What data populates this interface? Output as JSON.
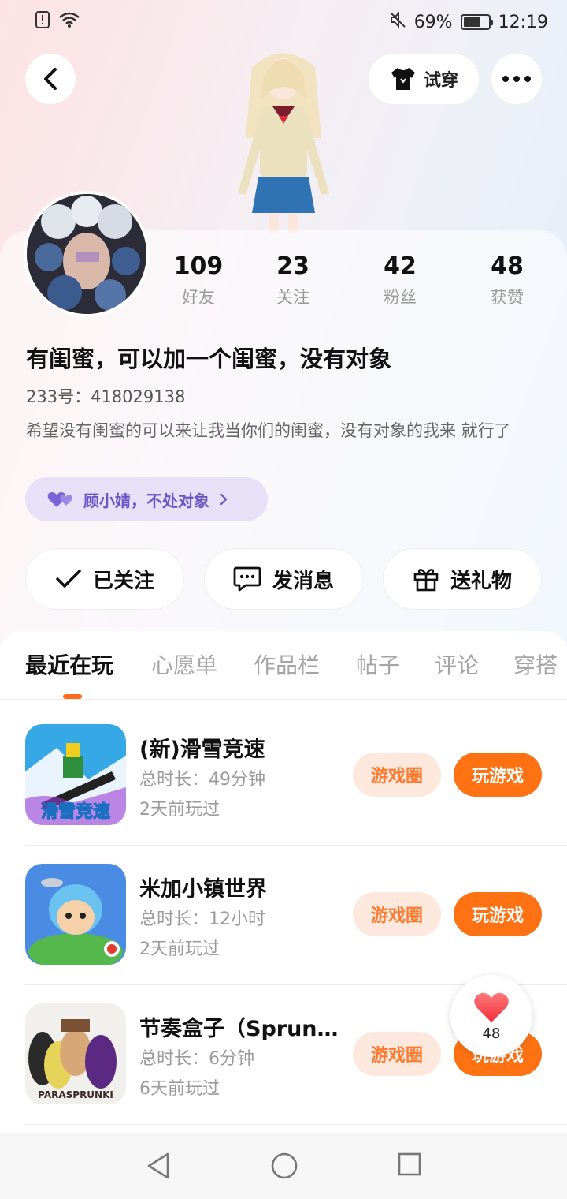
{
  "status_bar": {
    "battery": "69%",
    "time": "12:19",
    "battery_level": 0.69
  },
  "header": {
    "try_on_label": "试穿"
  },
  "profile": {
    "stats": [
      {
        "value": "109",
        "label": "好友"
      },
      {
        "value": "23",
        "label": "关注"
      },
      {
        "value": "42",
        "label": "粉丝"
      },
      {
        "value": "48",
        "label": "获赞"
      }
    ],
    "name": "有闺蜜，可以加一个闺蜜，没有对象",
    "uid": "233号：418029138",
    "bio": "希望没有闺蜜的可以来让我当你们的闺蜜，没有对象的我来 就行了",
    "tag": "顾小婧，不处对象"
  },
  "actions": {
    "follow": "已关注",
    "message": "发消息",
    "gift": "送礼物"
  },
  "tabs": [
    "最近在玩",
    "心愿单",
    "作品栏",
    "帖子",
    "评论",
    "穿搭"
  ],
  "games": [
    {
      "title": "(新)滑雪竞速",
      "duration": "总时长：49分钟",
      "last_played": "2天前玩过",
      "icon_text": "滑雪竞速",
      "circle_label": "游戏圈",
      "play_label": "玩游戏"
    },
    {
      "title": "米加小镇世界",
      "duration": "总时长：12小时",
      "last_played": "2天前玩过",
      "icon_text": "",
      "circle_label": "游戏圈",
      "play_label": "玩游戏"
    },
    {
      "title": "节奏盒子（Sprunki...",
      "duration": "总时长：6分钟",
      "last_played": "6天前玩过",
      "icon_text": "PARASPRUNKI",
      "circle_label": "游戏圈",
      "play_label": "玩游戏"
    }
  ],
  "like_fab": {
    "count": "48"
  },
  "colors": {
    "accent": "#ff7214",
    "accent_soft": "#fde8dd",
    "tag_bg": "#e6e1f7",
    "tag_text": "#6a55c6"
  }
}
